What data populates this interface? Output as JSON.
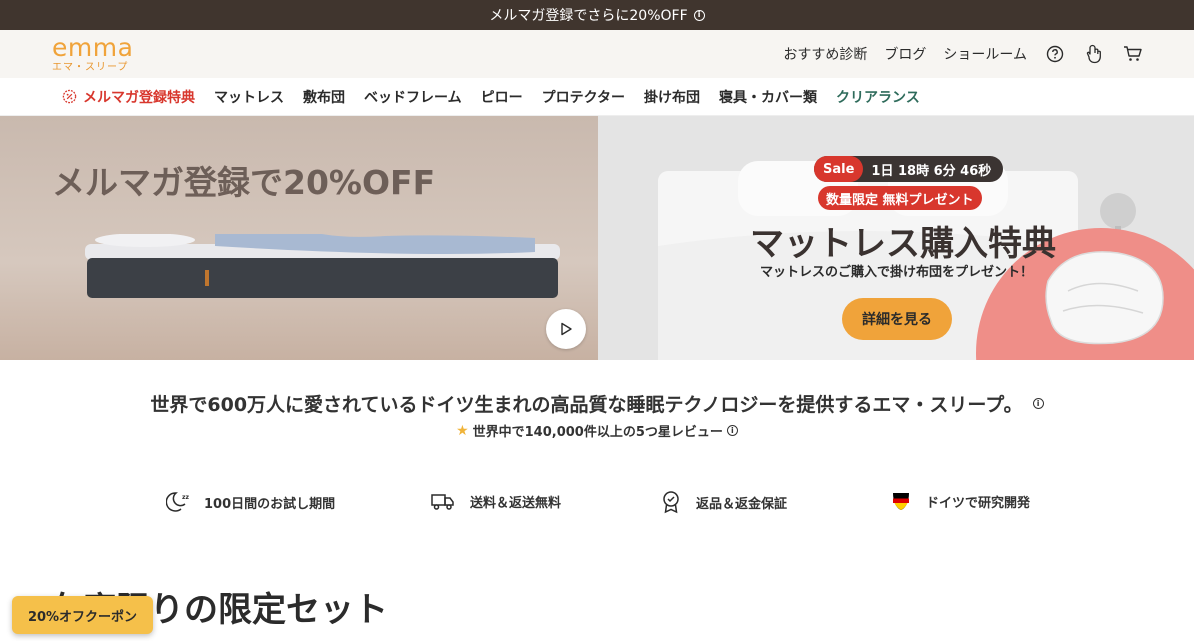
{
  "announcement": {
    "text": "メルマガ登録でさらに20%OFF",
    "info": "i"
  },
  "header": {
    "logo": "emma",
    "logo_sub": "エマ・スリープ",
    "links": [
      "おすすめ診断",
      "ブログ",
      "ショールーム"
    ]
  },
  "nav": {
    "promo": "メルマガ登録特典",
    "items": [
      "マットレス",
      "敷布団",
      "ベッドフレーム",
      "ピロー",
      "プロテクター",
      "掛け布団",
      "寝具・カバー類"
    ],
    "clearance": "クリアランス"
  },
  "hero": {
    "left_title": "メルマガ登録で20%OFF",
    "sale_tag": "Sale",
    "countdown": "1日 18時 6分 46秒",
    "gift": "数量限定 無料プレゼント",
    "right_title": "マットレス購入特典",
    "right_sub": "マットレスのご購入で掛け布団をプレゼント！",
    "cta": "詳細を見る"
  },
  "trust": {
    "main": "世界で600万人に愛されているドイツ生まれの高品質な睡眠テクノロジーを提供するエマ・スリープ。",
    "sub": "世界中で140,000件以上の5つ星レビュー",
    "info": "i"
  },
  "usps": [
    {
      "icon": "moon-sleep-icon",
      "label": "100日間のお試し期間"
    },
    {
      "icon": "truck-icon",
      "label": "送料＆返送無料"
    },
    {
      "icon": "award-badge-icon",
      "label": "返品＆返金保証"
    },
    {
      "icon": "germany-flag-icon",
      "label": "ドイツで研究開発"
    }
  ],
  "section_title": "在庫限りの限定セット",
  "coupon": "20%オフクーポン",
  "colors": {
    "brand_orange": "#f0a33a",
    "topbar": "#40352e",
    "sale_red": "#d8372d",
    "clearance_green": "#2e6b5b"
  }
}
